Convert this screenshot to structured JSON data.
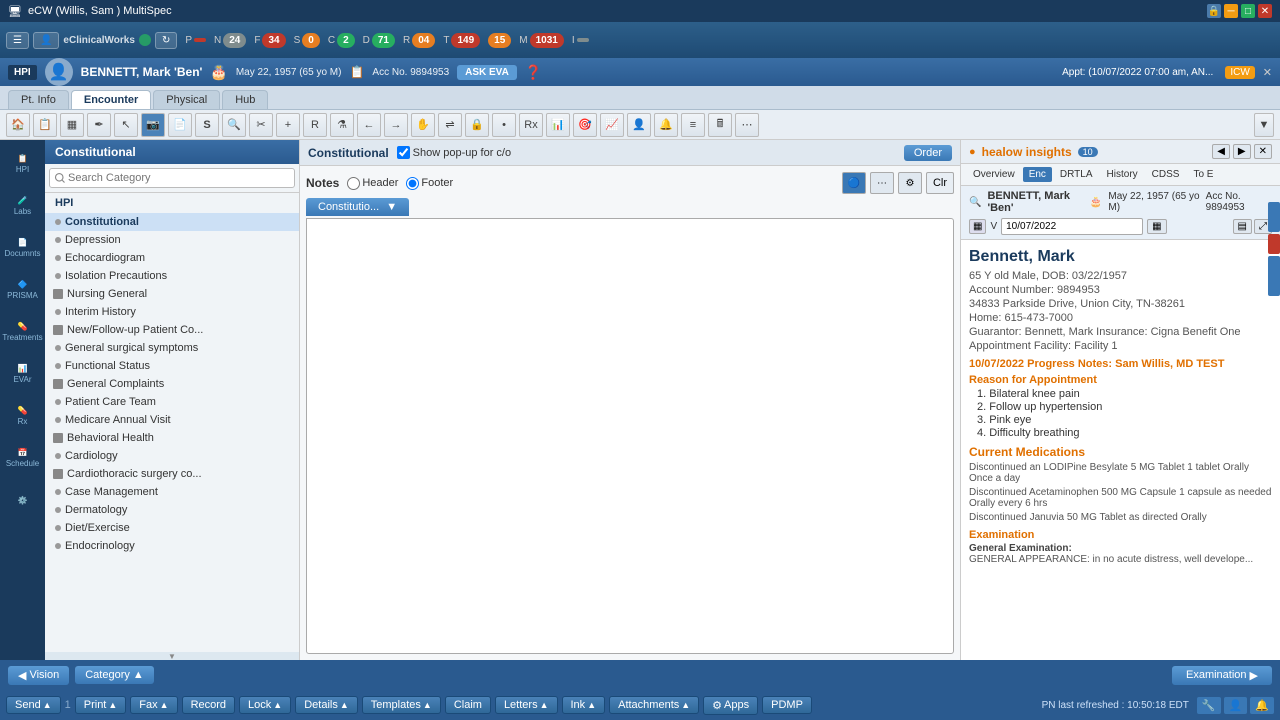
{
  "titlebar": {
    "title": "eCW (Willis, Sam ) MultiSpec",
    "lock_label": "Lock"
  },
  "topnav": {
    "logo": "eClinicalWorks",
    "status_items": [
      {
        "label": "P",
        "count": "",
        "color": "gray"
      },
      {
        "label": "S",
        "count": "0",
        "color": "orange"
      },
      {
        "label": "C",
        "count": "2",
        "color": "green"
      },
      {
        "label": "D",
        "count": "71",
        "color": "green"
      },
      {
        "label": "R",
        "count": "04",
        "color": "orange"
      },
      {
        "label": "T",
        "count": "149",
        "color": "red"
      },
      {
        "label": "15",
        "count": "",
        "color": "orange"
      },
      {
        "label": "M",
        "count": "1031",
        "color": "red"
      },
      {
        "label": "I",
        "count": "",
        "color": "gray"
      }
    ]
  },
  "patient_banner": {
    "hpi_label": "HPI",
    "patient_name": "BENNETT, Mark 'Ben'",
    "dob": "May 22, 1957 (65 yo M)",
    "acc_label": "Acc No. 9894953",
    "ask_eva": "ASK EVA",
    "appt_info": "Appt: (10/07/2022 07:00 am, AN...",
    "icw_label": "ICW"
  },
  "tabs": [
    {
      "label": "Pt. Info",
      "active": false
    },
    {
      "label": "Encounter",
      "active": true
    },
    {
      "label": "Physical",
      "active": false
    },
    {
      "label": "Hub",
      "active": false
    }
  ],
  "constitutional": {
    "title": "Constitutional",
    "show_popup_label": "Show pop-up for c/o",
    "order_btn": "Order"
  },
  "notes_panel": {
    "notes_label": "Notes",
    "header_radio": "Header",
    "footer_radio": "Footer",
    "footer_selected": true,
    "template_tab": "Constitutio...",
    "clr_label": "Clr"
  },
  "category": {
    "title": "Constitutional",
    "search_placeholder": "Search Category",
    "hpi_label": "HPI",
    "items": [
      {
        "label": "Constitutional",
        "active": true,
        "icon": "dash"
      },
      {
        "label": "Depression",
        "icon": "dash"
      },
      {
        "label": "Echocardiogram",
        "icon": "dash"
      },
      {
        "label": "Isolation Precautions",
        "icon": "dash"
      },
      {
        "label": "Nursing General",
        "icon": "square"
      },
      {
        "label": "Interim History",
        "icon": "dash"
      },
      {
        "label": "New/Follow-up Patient Co...",
        "icon": "square"
      },
      {
        "label": "General surgical symptoms",
        "icon": "dash"
      },
      {
        "label": "Functional Status",
        "icon": "dash"
      },
      {
        "label": "General Complaints",
        "icon": "square"
      },
      {
        "label": "Patient Care Team",
        "icon": "dash"
      },
      {
        "label": "Medicare Annual Visit",
        "icon": "dash"
      },
      {
        "label": "Behavioral Health",
        "icon": "square"
      },
      {
        "label": "Cardiology",
        "icon": "dash"
      },
      {
        "label": "Cardiothoracic surgery co...",
        "icon": "square"
      },
      {
        "label": "Case Management",
        "icon": "dash"
      },
      {
        "label": "Dermatology",
        "icon": "dash"
      },
      {
        "label": "Diet/Exercise",
        "icon": "dash"
      },
      {
        "label": "Endocrinology",
        "icon": "dash"
      }
    ]
  },
  "healow": {
    "title": "healow insights",
    "badge": "10",
    "tabs": [
      {
        "label": "Overview",
        "active": false
      },
      {
        "label": "Enc",
        "active": true
      },
      {
        "label": "DRTLA",
        "active": false
      },
      {
        "label": "History",
        "active": false
      },
      {
        "label": "CDSS",
        "active": false
      },
      {
        "label": "To E",
        "active": false
      }
    ],
    "patient_name": "BENNETT, Mark 'Ben'",
    "dob": "May 22, 1957 (65 yo M)",
    "acc_no": "Acc No. 9894953",
    "date": "10/07/2022",
    "big_name": "Bennett, Mark",
    "info_lines": [
      "65 Y old  Male, DOB: 03/22/1957",
      "Account Number: 9894953",
      "34833 Parkside Drive, Union City, TN-38261",
      "Home: 615-473-7000",
      "Guarantor: Bennett, Mark   Insurance: Cigna Benefit One",
      "Appointment Facility: Facility 1"
    ],
    "progress_title": "10/07/2022  Progress Notes: Sam Willis, MD TEST",
    "reason_title": "Reason for Appointment",
    "reasons": [
      "1. Bilateral knee pain",
      "2. Follow up hypertension",
      "3. Pink eye",
      "4. Difficulty breathing"
    ],
    "medications_title": "Current Medications",
    "medications": [
      "Discontinued an LODIPine Besylate 5 MG Tablet 1 tablet Orally Once a day",
      "Discontinued Acetaminophen 500 MG Capsule 1 capsule as needed Orally every 6 hrs",
      "Discontinued Januvia 50 MG Tablet as directed Orally"
    ],
    "examination_title": "Examination",
    "exam_sub": "General Examination:",
    "exam_text": "GENERAL APPEARANCE: in no acute distress, well develope..."
  },
  "bottom_bar": {
    "vision_btn": "Vision",
    "category_btn": "Category",
    "examination_btn": "Examination"
  },
  "footer_bar": {
    "buttons": [
      {
        "label": "Send",
        "has_arrow": true
      },
      {
        "label": "Print",
        "has_arrow": true
      },
      {
        "label": "Fax",
        "has_arrow": true
      },
      {
        "label": "Record",
        "has_arrow": false
      },
      {
        "label": "Lock",
        "has_arrow": true
      },
      {
        "label": "Details",
        "has_arrow": true
      },
      {
        "label": "Templates",
        "has_arrow": true
      },
      {
        "label": "Claim",
        "has_arrow": false
      },
      {
        "label": "Letters",
        "has_arrow": true
      },
      {
        "label": "Ink",
        "has_arrow": true
      },
      {
        "label": "Attachments",
        "has_arrow": true
      },
      {
        "label": "Apps",
        "has_arrow": false
      },
      {
        "label": "PDMP",
        "has_arrow": false
      }
    ],
    "pn_status": "PN  last refreshed : 10:50:18 EDT"
  },
  "sidebar_items": [
    {
      "label": "HPI",
      "icon": "📋"
    },
    {
      "label": "Labs",
      "icon": "🧪"
    },
    {
      "label": "Documnts",
      "icon": "📄"
    },
    {
      "label": "PRISMA",
      "icon": "🔷"
    },
    {
      "label": "Treatments",
      "icon": "💊"
    },
    {
      "label": "EVAr",
      "icon": "📊"
    },
    {
      "label": "Rx",
      "icon": "💊"
    },
    {
      "label": "Schedule",
      "icon": "📅"
    },
    {
      "label": "",
      "icon": "⚙️"
    }
  ]
}
